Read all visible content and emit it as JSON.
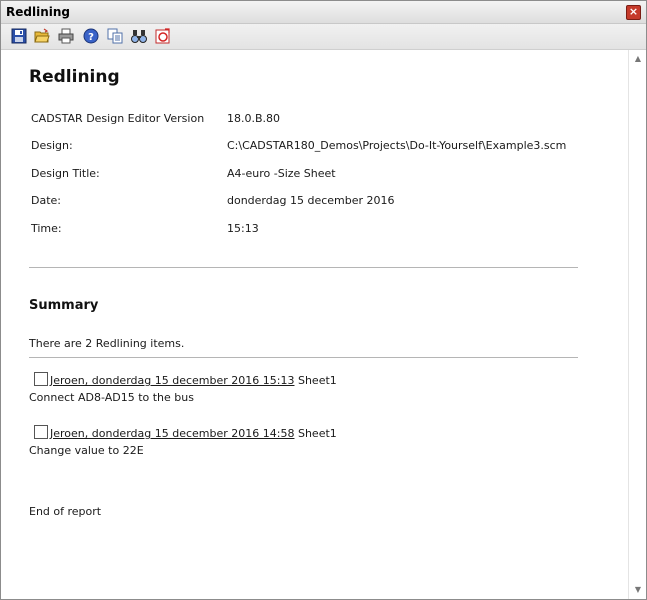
{
  "window": {
    "title": "Redlining",
    "close_label": "×"
  },
  "toolbar": {
    "buttons": [
      {
        "icon": "save-icon"
      },
      {
        "icon": "open-folder-icon"
      },
      {
        "icon": "print-icon"
      },
      {
        "icon": "help-icon"
      },
      {
        "icon": "copy-icon"
      },
      {
        "icon": "find-icon"
      },
      {
        "icon": "redline-icon"
      }
    ]
  },
  "report": {
    "heading": "Redlining",
    "info": [
      {
        "label": "CADSTAR Design Editor Version",
        "value": "18.0.B.80"
      },
      {
        "label": "Design:",
        "value": "C:\\CADSTAR180_Demos\\Projects\\Do-It-Yourself\\Example3.scm"
      },
      {
        "label": "Design Title:",
        "value": "A4-euro -Size Sheet"
      },
      {
        "label": "Date:",
        "value": "donderdag 15 december 2016"
      },
      {
        "label": "Time:",
        "value": "15:13"
      }
    ],
    "summary_heading": "Summary",
    "summary_text": "There are 2 Redlining items.",
    "items": [
      {
        "link": "Jeroen, donderdag 15 december 2016 15:13",
        "sheet": "Sheet1",
        "description": "Connect AD8-AD15 to the bus"
      },
      {
        "link": "Jeroen, donderdag 15 december 2016 14:58",
        "sheet": "Sheet1",
        "description": "Change value to 22E"
      }
    ],
    "end_text": "End of report"
  },
  "scrollbar": {
    "up_glyph": "▲",
    "down_glyph": "▼"
  }
}
